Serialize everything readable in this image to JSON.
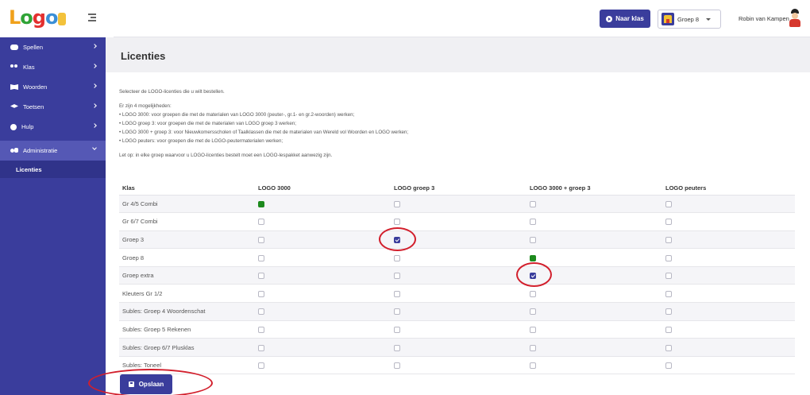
{
  "header": {
    "logo_text": [
      "L",
      "o",
      "g",
      "o"
    ],
    "naar_klas_label": "Naar klas",
    "group_label": "Groep 8",
    "user_name": "Robin van Kampen"
  },
  "sidebar": {
    "items": [
      {
        "label": "Spellen",
        "icon": "gamepad-icon"
      },
      {
        "label": "Klas",
        "icon": "users-icon"
      },
      {
        "label": "Woorden",
        "icon": "book-icon"
      },
      {
        "label": "Toetsen",
        "icon": "graduation-cap-icon"
      },
      {
        "label": "Hulp",
        "icon": "help-icon"
      },
      {
        "label": "Administratie",
        "icon": "admin-icon"
      }
    ],
    "sub_item": "Licenties"
  },
  "page": {
    "title": "Licenties",
    "intro": "Selecteer de LOGO-licenties die u wilt bestellen.",
    "options_heading": "Er zijn 4 mogelijkheden:",
    "options": [
      "• LOGO 3000: voor groepen die met de materialen van LOGO 3000 (peuter-, gr.1- en gr.2-woorden) werken;",
      "• LOGO groep 3: voor groepen die met de materialen van LOGO groep 3 werken;",
      "• LOGO 3000 + groep 3: voor Nieuwkomersscholen of Taalklassen die met de materialen van Wereld vol Woorden en LOGO werken;",
      "• LOGO peuters: voor groepen die met de LOGO-peutermaterialen werken;"
    ],
    "note": "Let op: in elke groep waarvoor u LOGO-licenties bestelt moet een LOGO-lespakket aanwezig zijn."
  },
  "table": {
    "headers": [
      "Klas",
      "LOGO 3000",
      "LOGO groep 3",
      "LOGO 3000 + groep 3",
      "LOGO peuters"
    ],
    "rows": [
      {
        "klas": "Gr 4/5 Combi",
        "cells": [
          "green",
          "empty",
          "empty",
          "empty"
        ]
      },
      {
        "klas": "Gr 6/7 Combi",
        "cells": [
          "empty",
          "empty",
          "empty",
          "empty"
        ]
      },
      {
        "klas": "Groep 3",
        "cells": [
          "empty",
          "checked",
          "empty",
          "empty"
        ]
      },
      {
        "klas": "Groep 8",
        "cells": [
          "empty",
          "empty",
          "green",
          "empty"
        ]
      },
      {
        "klas": "Groep extra",
        "cells": [
          "empty",
          "empty",
          "checked",
          "empty"
        ]
      },
      {
        "klas": "Kleuters Gr 1/2",
        "cells": [
          "empty",
          "empty",
          "empty",
          "empty"
        ]
      },
      {
        "klas": "Subles: Groep 4 Woordenschat",
        "cells": [
          "empty",
          "empty",
          "empty",
          "empty"
        ]
      },
      {
        "klas": "Subles: Groep 5 Rekenen",
        "cells": [
          "empty",
          "empty",
          "empty",
          "empty"
        ]
      },
      {
        "klas": "Subles: Groep 6/7 Plusklas",
        "cells": [
          "empty",
          "empty",
          "empty",
          "empty"
        ]
      },
      {
        "klas": "Subles: Toneel",
        "cells": [
          "empty",
          "empty",
          "empty",
          "empty"
        ]
      }
    ]
  },
  "save_label": "Opslaan",
  "colors": {
    "brand": "#3a3d9c",
    "checkbox_green": "#1d8a1d",
    "annotation_red": "#d21f2c"
  }
}
